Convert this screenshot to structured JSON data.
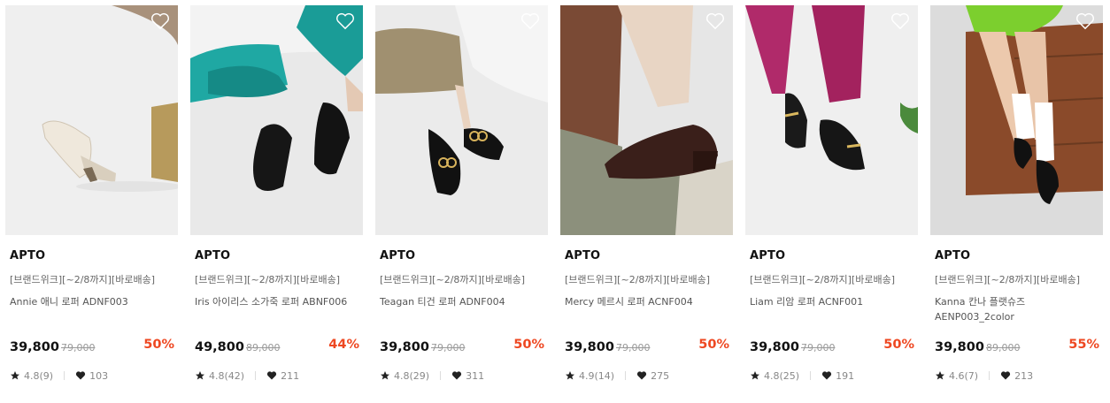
{
  "products": [
    {
      "brand": "APTO",
      "promo": "[브랜드위크][~2/8까지][바로배송]",
      "name": "Annie 애니 로퍼 ADNF003",
      "price": "39,800",
      "original_price": "79,000",
      "discount": "50%",
      "rating": "4.8(9)",
      "likes": "103"
    },
    {
      "brand": "APTO",
      "promo": "[브랜드위크][~2/8까지][바로배송]",
      "name": "Iris 아이리스 소가죽 로퍼 ABNF006",
      "price": "49,800",
      "original_price": "89,000",
      "discount": "44%",
      "rating": "4.8(42)",
      "likes": "211"
    },
    {
      "brand": "APTO",
      "promo": "[브랜드위크][~2/8까지][바로배송]",
      "name": "Teagan 티건 로퍼 ADNF004",
      "price": "39,800",
      "original_price": "79,000",
      "discount": "50%",
      "rating": "4.8(29)",
      "likes": "311"
    },
    {
      "brand": "APTO",
      "promo": "[브랜드위크][~2/8까지][바로배송]",
      "name": "Mercy 메르시 로퍼 ACNF004",
      "price": "39,800",
      "original_price": "79,000",
      "discount": "50%",
      "rating": "4.9(14)",
      "likes": "275"
    },
    {
      "brand": "APTO",
      "promo": "[브랜드위크][~2/8까지][바로배송]",
      "name": "Liam 리암 로퍼 ACNF001",
      "price": "39,800",
      "original_price": "79,000",
      "discount": "50%",
      "rating": "4.8(25)",
      "likes": "191"
    },
    {
      "brand": "APTO",
      "promo": "[브랜드위크][~2/8까지][바로배송]",
      "name": "Kanna 칸나 플랫슈즈 AENP003_2color",
      "price": "39,800",
      "original_price": "89,000",
      "discount": "55%",
      "rating": "4.6(7)",
      "likes": "213"
    }
  ],
  "icons": {
    "wishlist": "heart-outline-icon",
    "rating": "star-icon",
    "likes": "heart-filled-icon"
  },
  "colors": {
    "discount": "#ee4822",
    "price": "#111111",
    "muted": "#888888"
  }
}
